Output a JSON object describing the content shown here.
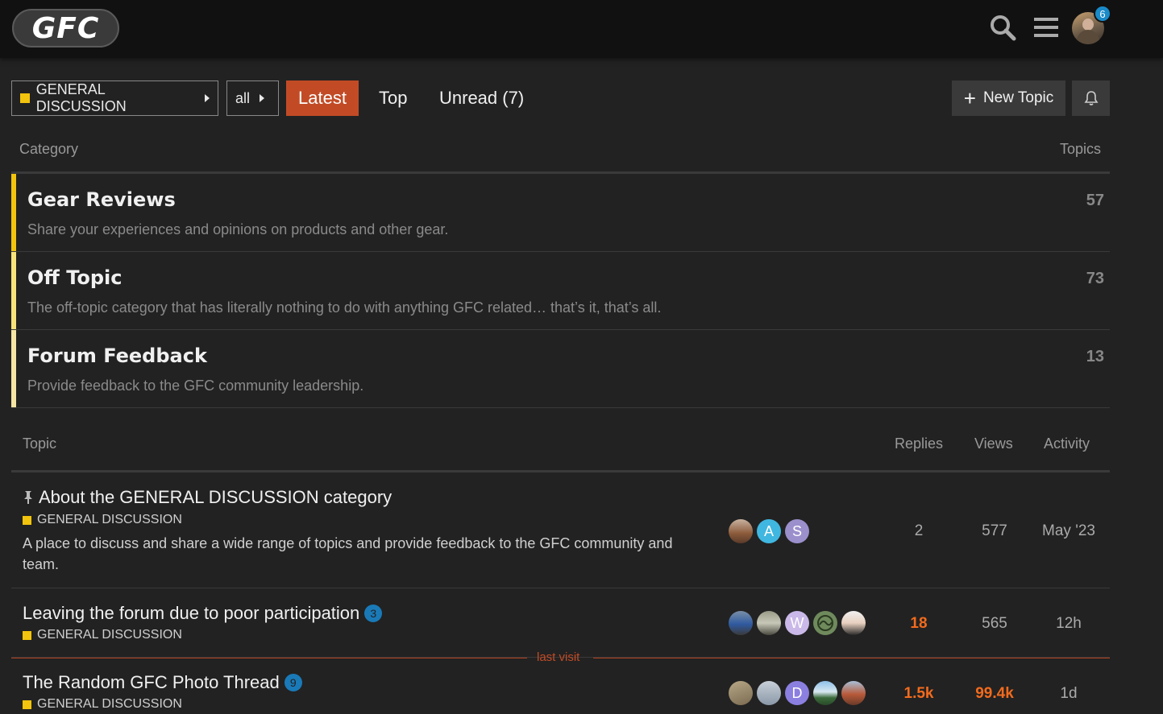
{
  "header": {
    "logo_text": "GFC",
    "notification_count": "6"
  },
  "nav": {
    "category_dropdown": "GENERAL DISCUSSION",
    "filter_dropdown": "all",
    "tabs": [
      {
        "label": "Latest",
        "active": true
      },
      {
        "label": "Top",
        "active": false
      },
      {
        "label": "Unread (7)",
        "active": false
      }
    ],
    "new_topic_label": "New Topic",
    "accent_color": "#c24b26",
    "category_color": "#f2c40d"
  },
  "categories": {
    "col_category": "Category",
    "col_topics": "Topics",
    "rows": [
      {
        "name": "Gear Reviews",
        "description": "Share your experiences and opinions on products and other gear.",
        "topics": "57"
      },
      {
        "name": "Off Topic",
        "description": "The off-topic category that has literally nothing to do with anything GFC related… that’s it, that’s all.",
        "topics": "73"
      },
      {
        "name": "Forum Feedback",
        "description": "Provide feedback to the GFC community leadership.",
        "topics": "13"
      }
    ]
  },
  "topics": {
    "col_topic": "Topic",
    "col_replies": "Replies",
    "col_views": "Views",
    "col_activity": "Activity",
    "last_visit_label": "last visit",
    "rows": [
      {
        "title": "About the GENERAL DISCUSSION category",
        "pinned": true,
        "category": "GENERAL DISCUSSION",
        "excerpt": "A place to discuss and share a wide range of topics and provide feedback to the GFC community and team.",
        "posters": [
          "",
          "A",
          "S"
        ],
        "replies": "2",
        "views": "577",
        "activity": "May '23"
      },
      {
        "title": "Leaving the forum due to poor participation",
        "unread": "3",
        "category": "GENERAL DISCUSSION",
        "posters": [
          "",
          "",
          "W",
          "",
          ""
        ],
        "replies": "18",
        "views": "565",
        "activity": "12h"
      },
      {
        "title": "The Random GFC Photo Thread",
        "unread": "9",
        "category": "GENERAL DISCUSSION",
        "posters": [
          "",
          "",
          "D",
          "",
          ""
        ],
        "replies": "1.5k",
        "views": "99.4k",
        "activity": "1d"
      }
    ]
  }
}
